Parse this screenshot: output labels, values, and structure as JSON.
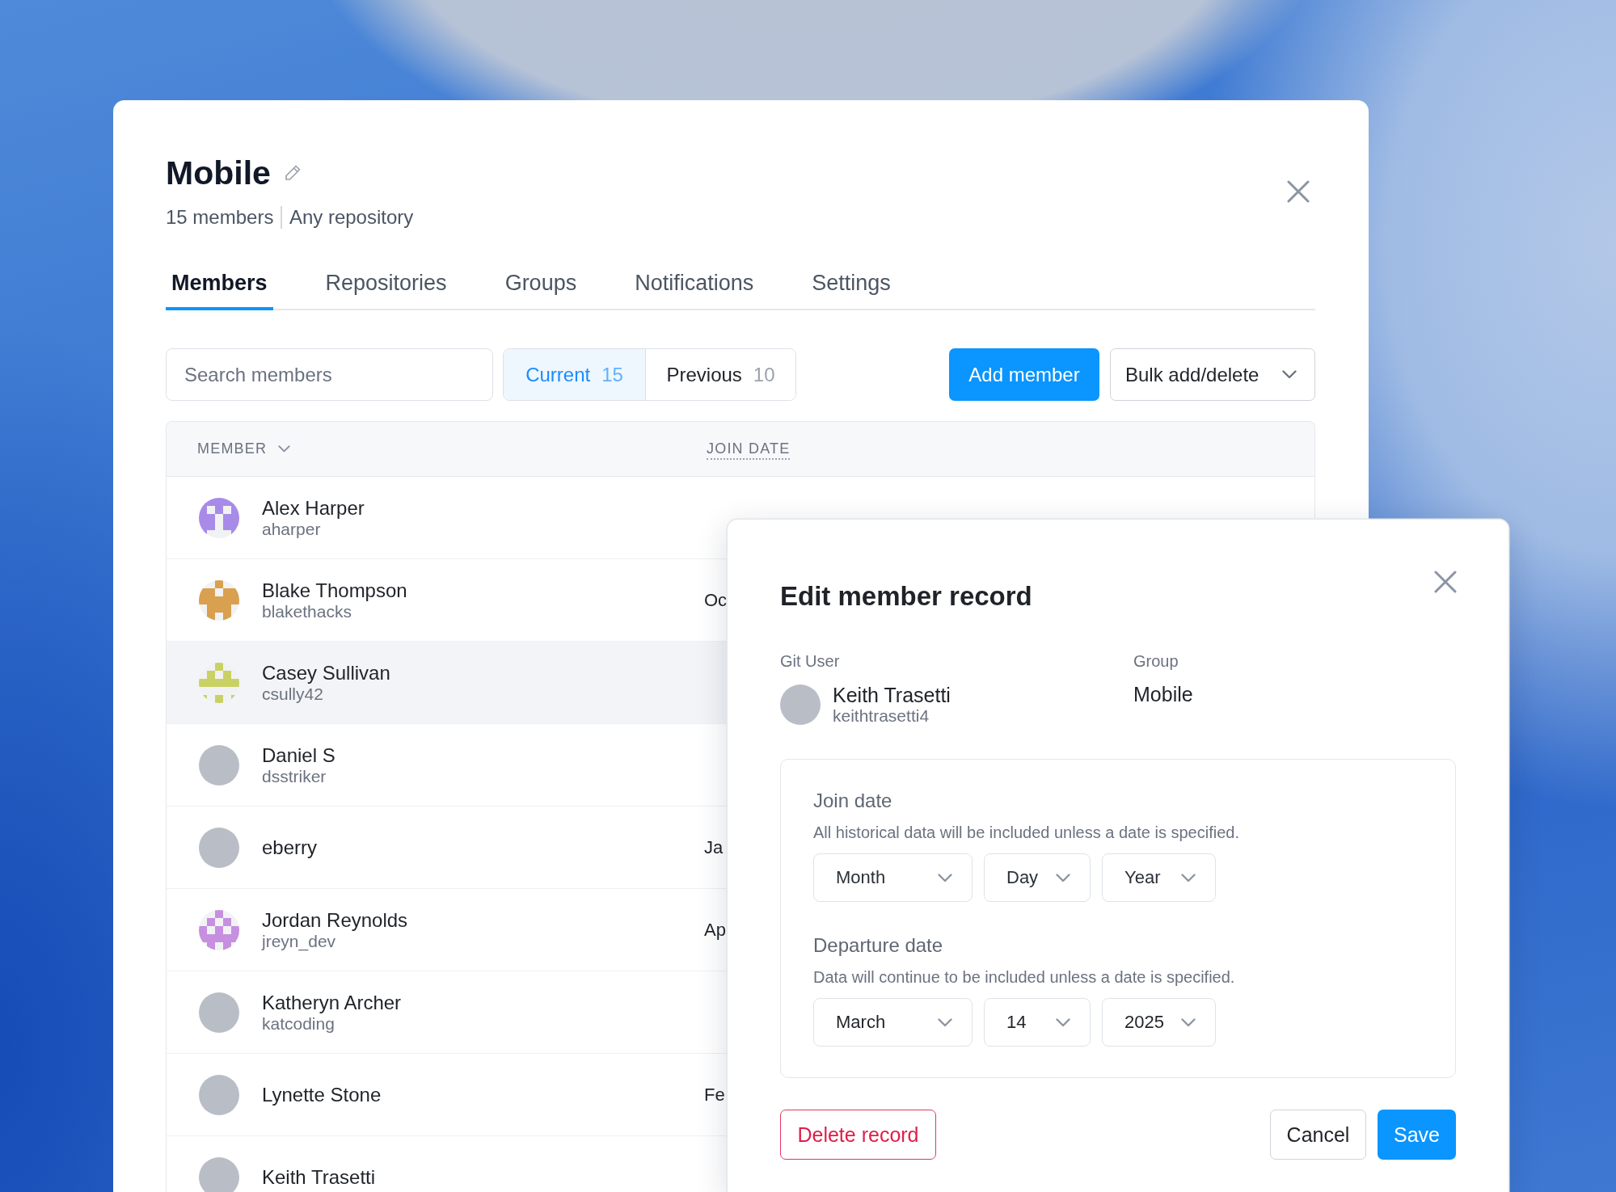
{
  "panel": {
    "title": "Mobile",
    "summary": [
      "15 members",
      "Any repository"
    ]
  },
  "tabs": [
    {
      "label": "Members",
      "selected": true
    },
    {
      "label": "Repositories",
      "selected": false
    },
    {
      "label": "Groups",
      "selected": false
    },
    {
      "label": "Notifications",
      "selected": false
    },
    {
      "label": "Settings",
      "selected": false
    }
  ],
  "search": {
    "placeholder": "Search members"
  },
  "filter": [
    {
      "label": "Current",
      "count": "15",
      "selected": true
    },
    {
      "label": "Previous",
      "count": "10",
      "selected": false
    }
  ],
  "actions": [
    {
      "label": "Add member",
      "kind": "primary"
    },
    {
      "label": "Bulk add/delete",
      "kind": "menu"
    }
  ],
  "table": {
    "columns": [
      {
        "label": "MEMBER",
        "kind": "sortable"
      },
      {
        "label": "JOIN DATE",
        "kind": "hint"
      }
    ],
    "rows": [
      {
        "name": "Alex Harper",
        "username": "aharper",
        "avatar": {
          "kind": "identicon",
          "color": "#a88be8"
        },
        "highlighted": false
      },
      {
        "name": "Blake Thompson",
        "username": "blakethacks",
        "avatar": {
          "kind": "identicon",
          "color": "#d9a04f"
        },
        "join_date": "Oc",
        "highlighted": false
      },
      {
        "name": "Casey Sullivan",
        "username": "csully42",
        "avatar": {
          "kind": "identicon",
          "color": "#c9d163"
        },
        "highlighted": true
      },
      {
        "name": "Daniel S",
        "username": "dsstriker",
        "avatar": {
          "kind": "photo"
        },
        "highlighted": false
      },
      {
        "name": "eberry",
        "avatar": {
          "kind": "photo"
        },
        "join_date": "Ja",
        "highlighted": false
      },
      {
        "name": "Jordan Reynolds",
        "username": "jreyn_dev",
        "avatar": {
          "kind": "identicon",
          "color": "#c78fe0"
        },
        "join_date": "Ap",
        "highlighted": false
      },
      {
        "name": "Katheryn Archer",
        "username": "katcoding",
        "avatar": {
          "kind": "photo"
        },
        "highlighted": false
      },
      {
        "name": "Lynette Stone",
        "avatar": {
          "kind": "photo"
        },
        "join_date": "Fe",
        "highlighted": false
      },
      {
        "name": "Keith Trasetti",
        "avatar": {
          "kind": "photo"
        },
        "highlighted": false
      }
    ]
  },
  "dialog": {
    "title": "Edit member record",
    "fields": [
      {
        "kind": "user",
        "label": "Git User",
        "name": "Keith Trasetti",
        "username": "keithtrasetti4",
        "avatar": {
          "kind": "photo"
        }
      },
      {
        "kind": "value",
        "label": "Group",
        "value": "Mobile"
      }
    ],
    "dates": [
      {
        "label": "Join date",
        "hint": "All historical data will be included unless a date is specified.",
        "selects": [
          {
            "placeholder": "Month"
          },
          {
            "placeholder": "Day"
          },
          {
            "placeholder": "Year"
          }
        ]
      },
      {
        "label": "Departure date",
        "hint": "Data will continue to be included unless a date is specified.",
        "selects": [
          {
            "value": "March"
          },
          {
            "value": "14"
          },
          {
            "value": "2025"
          }
        ]
      }
    ],
    "buttons": [
      {
        "label": "Delete record",
        "kind": "danger"
      },
      {
        "label": "Cancel",
        "kind": "secondary"
      },
      {
        "label": "Save",
        "kind": "primary"
      }
    ]
  }
}
